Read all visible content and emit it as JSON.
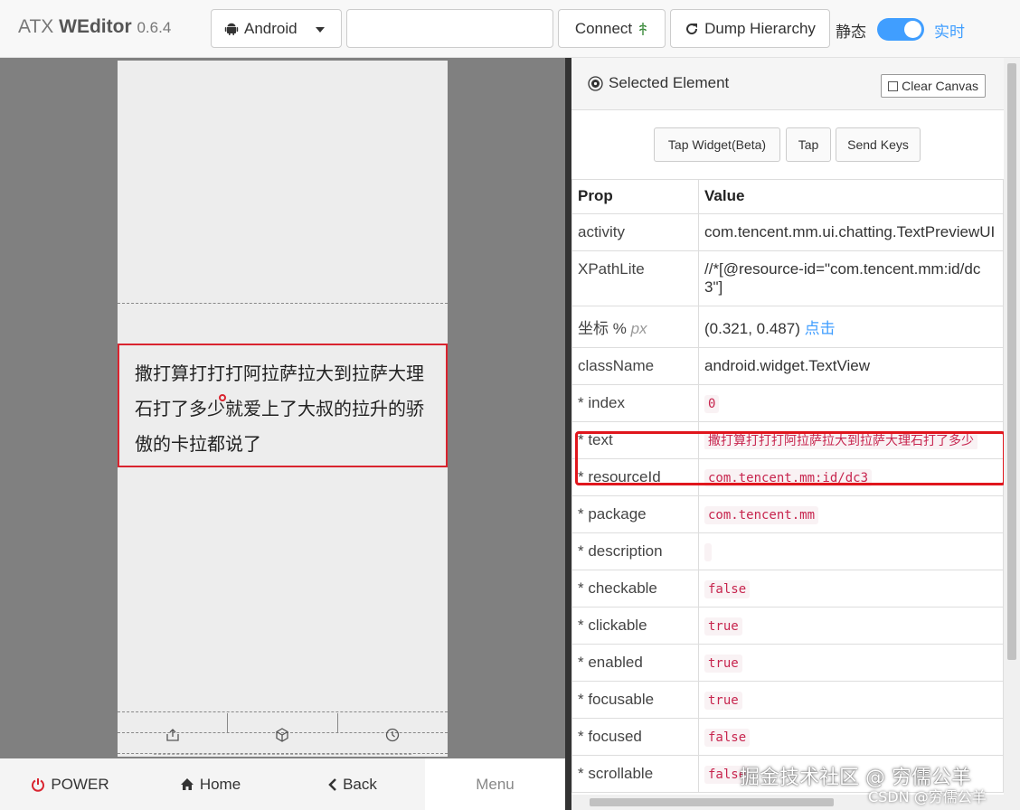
{
  "header": {
    "brand_prefix": "ATX",
    "brand_name": "WEditor",
    "version": "0.6.4",
    "platform": "Android",
    "serial_value": "",
    "connect_label": "Connect",
    "dump_label": "Dump Hierarchy",
    "static_label": "静态",
    "live_label": "实时",
    "live_enabled": true,
    "accent_color": "#409eff"
  },
  "device": {
    "chat_text": "撒打算打打打阿拉萨拉大到拉萨大理石打了多少就爱上了大叔的拉升的骄傲的卡拉都说了",
    "highlight_color": "#d9242f",
    "nav": {
      "power_label": "POWER",
      "home_label": "Home",
      "back_label": "Back",
      "menu_label": "Menu"
    }
  },
  "inspector": {
    "title": "Selected Element",
    "clear_canvas_label": "Clear Canvas",
    "actions": {
      "tap_widget_label": "Tap Widget(Beta)",
      "tap_label": "Tap",
      "send_keys_label": "Send Keys"
    },
    "table": {
      "col_prop": "Prop",
      "col_value": "Value",
      "activity": {
        "prop": "activity",
        "value": "com.tencent.mm.ui.chatting.TextPreviewUI"
      },
      "xpath": {
        "prop": "XPathLite",
        "value": "//*[@resource-id=\"com.tencent.mm:id/dc3\"]"
      },
      "coords": {
        "prop": "坐标",
        "unit_pct": "%",
        "unit_px": "px",
        "value": "(0.321, 0.487)",
        "link": "点击"
      },
      "classname": {
        "prop": "className",
        "value": "android.widget.TextView"
      },
      "index": {
        "prop": "* index",
        "value": "0"
      },
      "text": {
        "prop": "* text",
        "value": "撒打算打打打阿拉萨拉大到拉萨大理石打了多少"
      },
      "resourceid": {
        "prop": "* resourceId",
        "value": "com.tencent.mm:id/dc3"
      },
      "package": {
        "prop": "* package",
        "value": "com.tencent.mm"
      },
      "description": {
        "prop": "* description",
        "value": ""
      },
      "checkable": {
        "prop": "* checkable",
        "value": "false"
      },
      "clickable": {
        "prop": "* clickable",
        "value": "true"
      },
      "enabled": {
        "prop": "* enabled",
        "value": "true"
      },
      "focusable": {
        "prop": "* focusable",
        "value": "true"
      },
      "focused": {
        "prop": "* focused",
        "value": "false"
      },
      "scrollable": {
        "prop": "* scrollable",
        "value": "false"
      }
    }
  },
  "watermark": {
    "main": "掘金技术社区 @ 穷儒公羊",
    "sub": "CSDN @穷儒公羊"
  }
}
